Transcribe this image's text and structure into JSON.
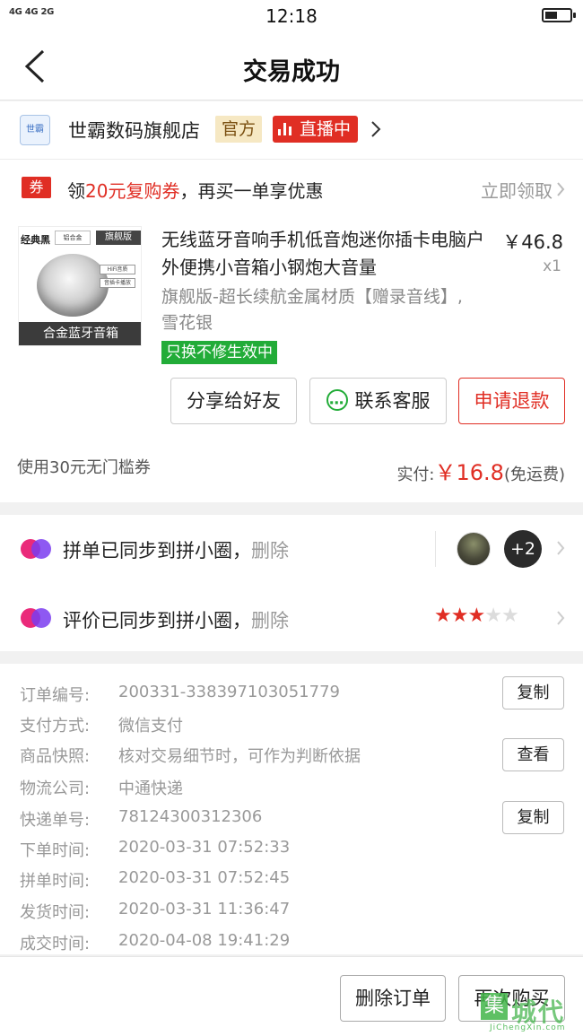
{
  "status_bar": {
    "signal": "4G 4G 2G",
    "time": "12:18",
    "battery_level": 0.5
  },
  "nav": {
    "title": "交易成功"
  },
  "shop": {
    "logo_text": "世霸",
    "name": "世霸数码旗舰店",
    "official_tag": "官方",
    "live_tag": "直播中"
  },
  "coupon": {
    "icon": "券",
    "text_prefix": "领",
    "highlight": "20元复购券",
    "text_suffix": "，再买一单享优惠",
    "link": "立即领取"
  },
  "product": {
    "image": {
      "brand": "经典黑",
      "badge": "铝合金",
      "edition": "旗舰版",
      "feature1": "HiFi音质",
      "feature2": "音插卡播放",
      "footer": "合金蓝牙音箱"
    },
    "title": "无线蓝牙音响手机低音炮迷你插卡电脑户外便携小音箱小钢炮大音量",
    "price": "￥46.8",
    "qty": "x1",
    "spec": "旗舰版-超长续航金属材质【赠录音线】,雪花银",
    "guarantee": "只换不修生效中"
  },
  "actions": {
    "share": "分享给好友",
    "contact": "联系客服",
    "refund": "申请退款"
  },
  "summary": {
    "coupon_used": "使用30元无门槛券",
    "paid_label": "实付:",
    "paid_amount": "￥16.8",
    "shipping": "(免运费)"
  },
  "sync": [
    {
      "text": "拼单已同步到拼小圈，",
      "action": "删除",
      "avatar_more": "+2"
    },
    {
      "text": "评价已同步到拼小圈，",
      "action": "删除",
      "rating": 3,
      "max_rating": 5
    }
  ],
  "details": [
    {
      "label": "订单编号:",
      "value": "200331-338397103051779",
      "button": "复制"
    },
    {
      "label": "支付方式:",
      "value": "微信支付"
    },
    {
      "label": "商品快照:",
      "value": "核对交易细节时，可作为判断依据",
      "button": "查看"
    },
    {
      "label": "物流公司:",
      "value": "中通快递"
    },
    {
      "label": "快递单号:",
      "value": "78124300312306",
      "button": "复制"
    },
    {
      "label": "下单时间:",
      "value": "2020-03-31 07:52:33"
    },
    {
      "label": "拼单时间:",
      "value": "2020-03-31 07:52:45"
    },
    {
      "label": "发货时间:",
      "value": "2020-03-31 11:36:47"
    },
    {
      "label": "成交时间:",
      "value": "2020-04-08 19:41:29"
    }
  ],
  "bottom": {
    "delete": "删除订单",
    "rebuy": "再次购买"
  },
  "watermark": {
    "box": "集",
    "text": "城代码",
    "sub": "JiChengXin.com"
  },
  "colors": {
    "accent_red": "#e02e24",
    "green": "#22ac38",
    "official_bg": "#f6e8c3",
    "star_on": "#e02e24",
    "star_off": "#dcdcdc"
  }
}
